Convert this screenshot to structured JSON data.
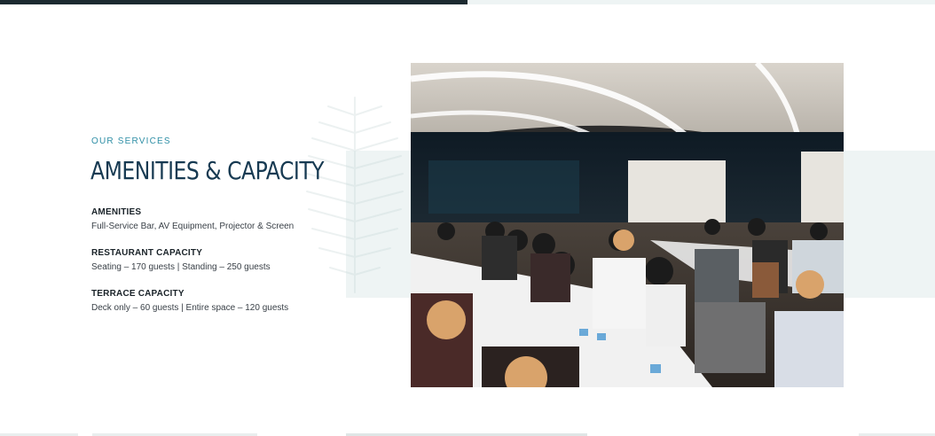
{
  "services": {
    "eyebrow": "OUR SERVICES",
    "title": "AMENITIES & CAPACITY",
    "items": [
      {
        "label": "AMENITIES",
        "value": "Full-Service Bar, AV Equipment, Projector & Screen"
      },
      {
        "label": "RESTAURANT CAPACITY",
        "value": "Seating – 170 guests | Standing – 250 guests"
      },
      {
        "label": "TERRACE CAPACITY",
        "value": "Deck only – 60 guests | Entire space – 120 guests"
      }
    ]
  },
  "colors": {
    "accent": "#2f8fa6",
    "heading": "#173a52",
    "panel": "#eef4f4"
  },
  "icons": {
    "decor": "fern-leaf-icon"
  }
}
